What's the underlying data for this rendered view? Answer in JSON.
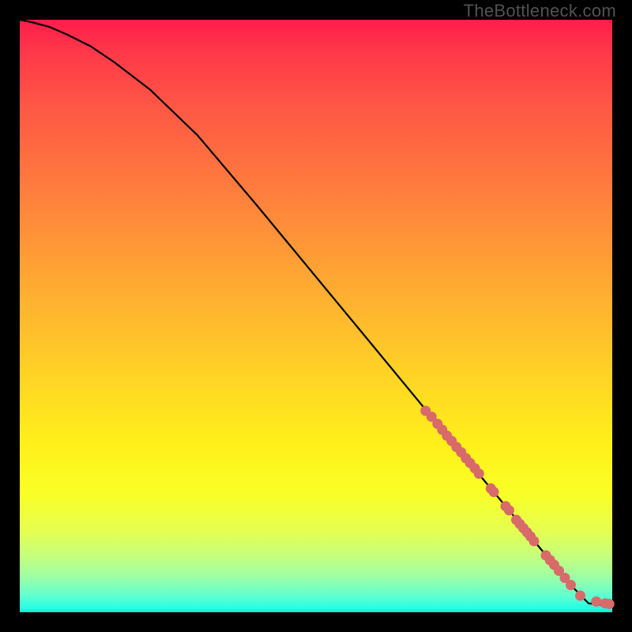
{
  "watermark": "TheBottleneck.com",
  "chart_data": {
    "type": "line",
    "title": "",
    "xlabel": "",
    "ylabel": "",
    "xlim": [
      0,
      100
    ],
    "ylim": [
      0,
      100
    ],
    "grid": false,
    "series": [
      {
        "name": "curve",
        "x": [
          0,
          2,
          5,
          8,
          12,
          16,
          22,
          30,
          40,
          50,
          60,
          68,
          75,
          80,
          84,
          87,
          90,
          93,
          96,
          100
        ],
        "values": [
          100,
          99.6,
          98.8,
          97.5,
          95.5,
          92.8,
          88.2,
          80.5,
          68.7,
          56.6,
          44.5,
          34.8,
          26.3,
          20.3,
          15.5,
          11.8,
          8.2,
          4.6,
          1.5,
          1.0
        ]
      }
    ],
    "points": {
      "name": "scatter",
      "x": [
        68.5,
        69.5,
        70.5,
        71.3,
        72.1,
        72.9,
        73.7,
        74.5,
        75.3,
        76.0,
        76.8,
        77.5,
        79.5,
        80.0,
        82.0,
        82.6,
        83.8,
        84.4,
        85.0,
        85.6,
        86.2,
        86.8,
        88.8,
        89.5,
        90.2,
        91.0,
        92.0,
        93.0,
        94.6,
        97.3,
        98.8,
        99.5
      ],
      "values": [
        34.0,
        33.0,
        31.8,
        30.8,
        29.8,
        28.9,
        27.9,
        27.0,
        26.0,
        25.2,
        24.3,
        23.4,
        20.9,
        20.3,
        17.9,
        17.2,
        15.6,
        14.9,
        14.2,
        13.5,
        12.8,
        12.0,
        9.6,
        8.8,
        8.0,
        7.0,
        5.8,
        4.6,
        2.8,
        1.8,
        1.5,
        1.4
      ]
    },
    "legend": false
  }
}
